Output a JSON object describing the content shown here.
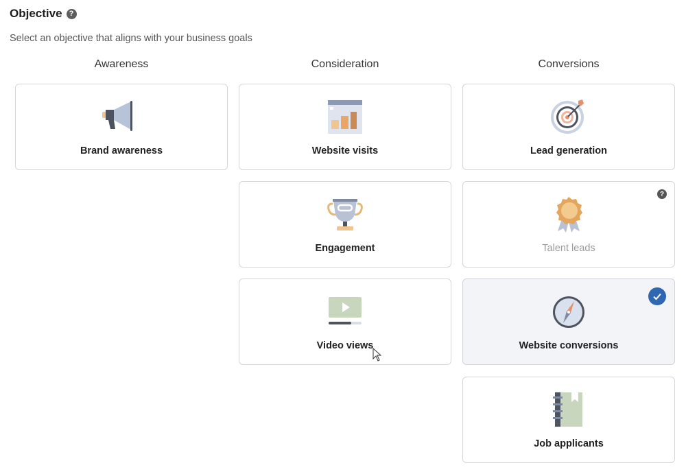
{
  "header": {
    "title": "Objective",
    "help_glyph": "?"
  },
  "subtitle": "Select an objective that aligns with your business goals",
  "columns": [
    {
      "heading": "Awareness"
    },
    {
      "heading": "Consideration"
    },
    {
      "heading": "Conversions"
    }
  ],
  "cards": {
    "brand_awareness": {
      "label": "Brand awareness",
      "icon": "megaphone-icon"
    },
    "website_visits": {
      "label": "Website visits",
      "icon": "bar-chart-icon"
    },
    "engagement": {
      "label": "Engagement",
      "icon": "trophy-icon"
    },
    "video_views": {
      "label": "Video views",
      "icon": "video-play-icon"
    },
    "lead_generation": {
      "label": "Lead generation",
      "icon": "target-icon"
    },
    "talent_leads": {
      "label": "Talent leads",
      "icon": "award-ribbon-icon",
      "help_glyph": "?",
      "disabled": true
    },
    "website_conversions": {
      "label": "Website conversions",
      "icon": "compass-icon",
      "selected": true
    },
    "job_applicants": {
      "label": "Job applicants",
      "icon": "notebook-icon"
    }
  },
  "colors": {
    "selected_check": "#2f67b2",
    "selected_bg": "#f3f4f8",
    "border": "#d6d6d6"
  }
}
